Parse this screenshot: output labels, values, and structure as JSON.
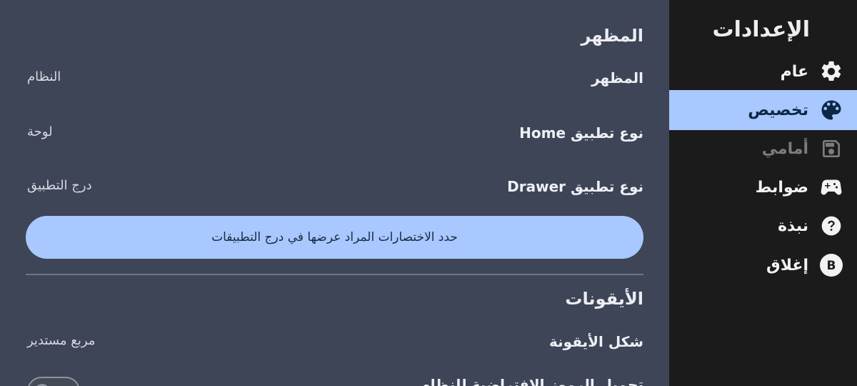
{
  "sidebar": {
    "title": "الإعدادات",
    "items": [
      {
        "label": "عام",
        "icon": "gear-icon",
        "active": false
      },
      {
        "label": "تخصيص",
        "icon": "palette-icon",
        "active": true
      },
      {
        "label": "أمامي",
        "icon": "save-icon",
        "active": false,
        "disabled": true
      },
      {
        "label": "ضوابط",
        "icon": "gamepad-icon",
        "active": false
      },
      {
        "label": "نبذة",
        "icon": "help-circle-icon",
        "active": false
      },
      {
        "label": "إغلاق",
        "icon": "b-button-icon",
        "icon_text": "B",
        "active": false
      }
    ],
    "colors": {
      "active_bg": "#a8c8ff",
      "bg": "#1b1b1b"
    }
  },
  "main": {
    "appearance_section": {
      "title": "المظهر",
      "rows": [
        {
          "label": "المظهر",
          "value": "النظام"
        },
        {
          "label": "نوع تطبيق Home",
          "value": "لوحة"
        },
        {
          "label": "نوع تطبيق Drawer",
          "value": "درج التطبيق"
        }
      ],
      "button_label": "حدد الاختصارات المراد عرضها في درج التطبيقات"
    },
    "icons_section": {
      "title": "الأيقونات",
      "rows": [
        {
          "label": "شكل الأيقونة",
          "value": "مربع مستدير"
        },
        {
          "label": "تحميل الرموز الافتراضية للنظام",
          "toggle": "off"
        }
      ]
    },
    "colors": {
      "bg": "#3d4557",
      "accent": "#a8c8ff"
    }
  }
}
